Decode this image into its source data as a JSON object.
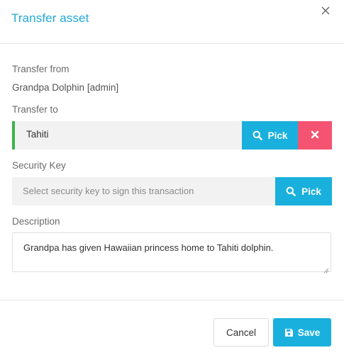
{
  "modal": {
    "title": "Transfer asset"
  },
  "transfer_from": {
    "label": "Transfer from",
    "value": "Grandpa Dolphin [admin]"
  },
  "transfer_to": {
    "label": "Transfer to",
    "value": "Tahiti",
    "pick_label": "Pick",
    "accent_color": "#3db34a"
  },
  "security_key": {
    "label": "Security Key",
    "placeholder": "Select security key to sign this transaction",
    "pick_label": "Pick"
  },
  "description": {
    "label": "Description",
    "value": "Grandpa has given Hawaiian princess home to Tahiti dolphin."
  },
  "footer": {
    "cancel_label": "Cancel",
    "save_label": "Save"
  },
  "icons": {
    "close": "close-icon",
    "search": "search-icon",
    "clear": "times-icon",
    "save": "floppy-disk-icon"
  },
  "colors": {
    "title": "#1fa8d6",
    "primary": "#1ab0dd",
    "danger": "#f45471",
    "success": "#3db34a"
  }
}
